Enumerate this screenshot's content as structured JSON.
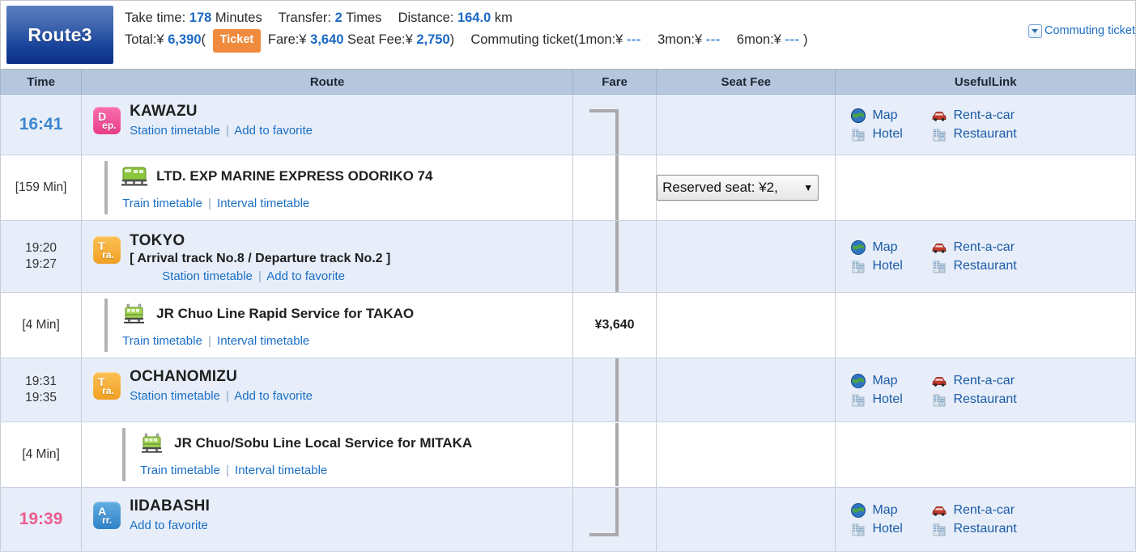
{
  "header": {
    "route_label": "Route3",
    "take_time_label": "Take time:",
    "take_time_value": "178",
    "take_time_unit": "Minutes",
    "transfer_label": "Transfer:",
    "transfer_value": "2",
    "transfer_unit": "Times",
    "distance_label": "Distance:",
    "distance_value": "164.0",
    "distance_unit": "km",
    "total_label": "Total:¥",
    "total_value": "6,390",
    "paren_open": "(",
    "ticket_chip": "Ticket",
    "fare_label": "Fare:¥",
    "fare_value": "3,640",
    "seatfee_label": "Seat Fee:¥",
    "seatfee_value": "2,750",
    "paren_close": ")",
    "commuting_prefix": "Commuting ticket(1mon:¥",
    "commuting_1mon": "---",
    "commuting_3mon_label": "3mon:¥",
    "commuting_3mon": "---",
    "commuting_6mon_label": "6mon:¥",
    "commuting_6mon": "---",
    "commuting_suffix": ")",
    "commuting_link": "Commuting ticket"
  },
  "columns": {
    "time": "Time",
    "route": "Route",
    "fare": "Fare",
    "seat_fee": "Seat Fee",
    "useful_link": "UsefulLink"
  },
  "links": {
    "station_timetable": "Station timetable",
    "add_to_favorite": "Add to favorite",
    "train_timetable": "Train timetable",
    "interval_timetable": "Interval timetable",
    "separator": "|"
  },
  "useful_links": {
    "map": "Map",
    "rent_a_car": "Rent-a-car",
    "hotel": "Hotel",
    "restaurant": "Restaurant"
  },
  "rows": {
    "r1": {
      "time": "16:41",
      "station": "KAWAZU",
      "badge_top": "D",
      "badge_bottom": "ep."
    },
    "r2": {
      "time": "[159 Min]",
      "train": "LTD. EXP MARINE EXPRESS ODORIKO 74",
      "seat_select": "Reserved seat: ¥2,",
      "seat_arrow": "▼"
    },
    "r3": {
      "time_arr": "19:20",
      "time_dep": "19:27",
      "station": "TOKYO",
      "track": "[ Arrival track No.8 / Departure track No.2 ]",
      "badge_top": "T",
      "badge_bottom": "ra."
    },
    "r4": {
      "time": "[4 Min]",
      "train": "JR Chuo Line Rapid Service  for TAKAO",
      "fare": "¥3,640"
    },
    "r5": {
      "time_arr": "19:31",
      "time_dep": "19:35",
      "station": "OCHANOMIZU",
      "badge_top": "T",
      "badge_bottom": "ra."
    },
    "r6": {
      "time": "[4 Min]",
      "train": "JR Chuo/Sobu Line Local Service  for MITAKA"
    },
    "r7": {
      "time": "19:39",
      "station": "IIDABASHI",
      "badge_top": "A",
      "badge_bottom": "rr."
    }
  },
  "colors": {
    "accent_blue": "#1b69c4",
    "dep_time": "#3c87cf",
    "arr_time": "#ec5c8e",
    "ticket_orange": "#f08a3c",
    "header_bg": "#b6c6dd",
    "station_row_bg": "#e7eef9"
  }
}
